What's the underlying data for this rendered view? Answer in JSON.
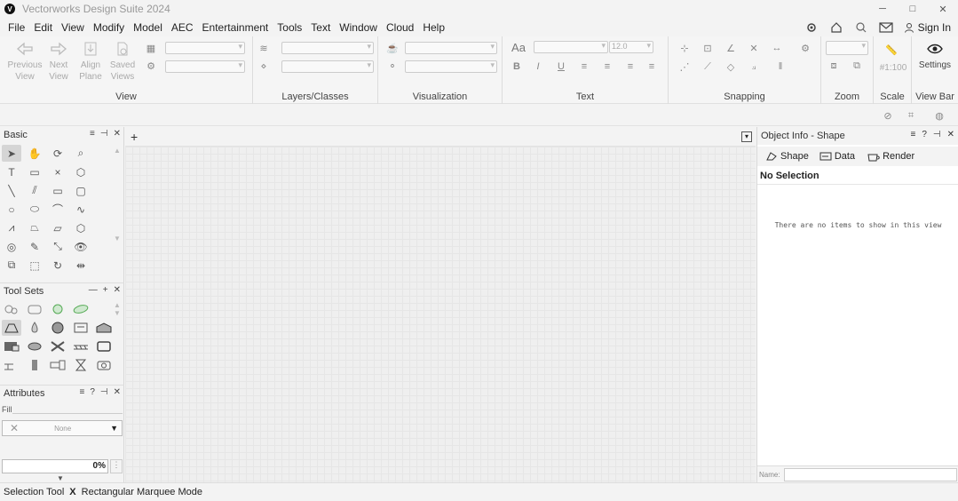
{
  "window": {
    "title": "Vectorworks Design Suite 2024",
    "logo_letter": "V",
    "controls": [
      "─",
      "□",
      "✕"
    ]
  },
  "menubar": {
    "items": [
      "File",
      "Edit",
      "View",
      "Modify",
      "Model",
      "AEC",
      "Entertainment",
      "Tools",
      "Text",
      "Window",
      "Cloud",
      "Help"
    ],
    "sign_in": "Sign In"
  },
  "ribbon": {
    "view": {
      "label": "View",
      "previous": "Previous View",
      "next": "Next View",
      "align_plane": "Align Plane",
      "saved_views": "Saved Views"
    },
    "layers_label": "Layers/Classes",
    "visualization_label": "Visualization",
    "text": {
      "label": "Text",
      "size_value": "12.0",
      "bold": "B",
      "italic": "I",
      "underline": "U",
      "font_glyph": "Aa"
    },
    "snapping_label": "Snapping",
    "zoom_label": "Zoom",
    "scale": {
      "label": "Scale",
      "value": "#1:100"
    },
    "viewbar": {
      "label": "View Bar",
      "settings": "Settings"
    }
  },
  "palettes": {
    "basic": {
      "title": "Basic",
      "controls": [
        "≡",
        "⊣",
        "✕"
      ]
    },
    "toolsets": {
      "title": "Tool Sets",
      "controls": [
        "—",
        "+",
        "✕"
      ]
    },
    "attributes": {
      "title": "Attributes",
      "controls": [
        "≡",
        "?",
        "⊣",
        "✕"
      ],
      "fill_label": "Fill",
      "fill_value": "None",
      "opacity_value": "0%"
    }
  },
  "canvas": {
    "add_tab": "+"
  },
  "oip": {
    "title": "Object Info - Shape",
    "controls": [
      "≡",
      "?",
      "⊣",
      "✕"
    ],
    "tabs": [
      "Shape",
      "Data",
      "Render"
    ],
    "selection": "No Selection",
    "empty_message": "There are no items to show in this view",
    "name_label": "Name:"
  },
  "status": {
    "tool": "Selection Tool",
    "separator": "X",
    "mode": "Rectangular Marquee Mode"
  }
}
